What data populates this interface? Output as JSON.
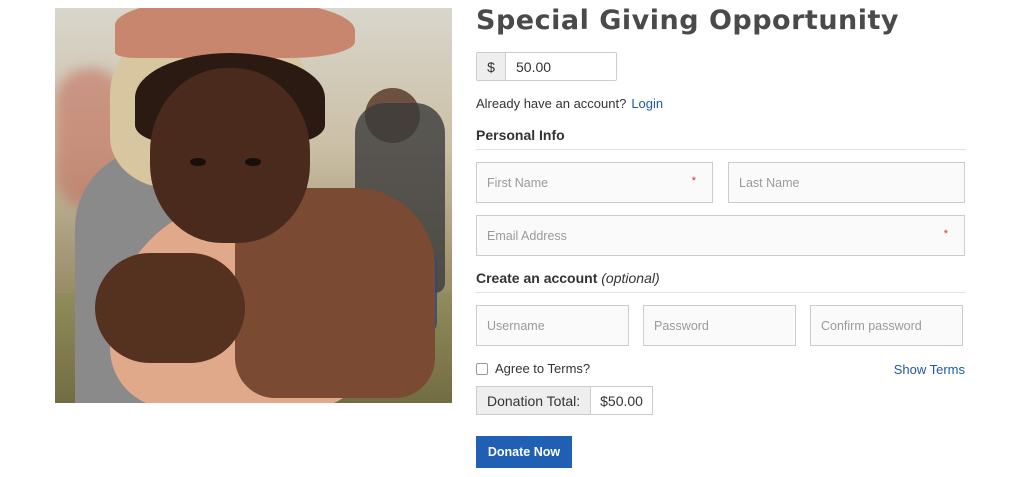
{
  "title": "Special Giving Opportunity",
  "amount": {
    "currency": "$",
    "value": "50.00"
  },
  "account_prompt": {
    "text": "Already have an account?",
    "login_label": "Login"
  },
  "personal_info": {
    "heading": "Personal Info",
    "first_name_placeholder": "First Name",
    "last_name_placeholder": "Last Name",
    "email_placeholder": "Email Address",
    "required_mark": "*"
  },
  "create_account": {
    "heading": "Create an account",
    "optional_label": "(optional)",
    "username_placeholder": "Username",
    "password_placeholder": "Password",
    "confirm_password_placeholder": "Confirm password"
  },
  "terms": {
    "agree_label": "Agree to Terms?",
    "show_terms_label": "Show Terms",
    "checked": false
  },
  "donation_total": {
    "label": "Donation Total:",
    "value": "$50.00"
  },
  "donate_button_label": "Donate Now",
  "colors": {
    "accent": "#1f5fb4",
    "link": "#1e5aa8",
    "required": "#c0392b"
  }
}
